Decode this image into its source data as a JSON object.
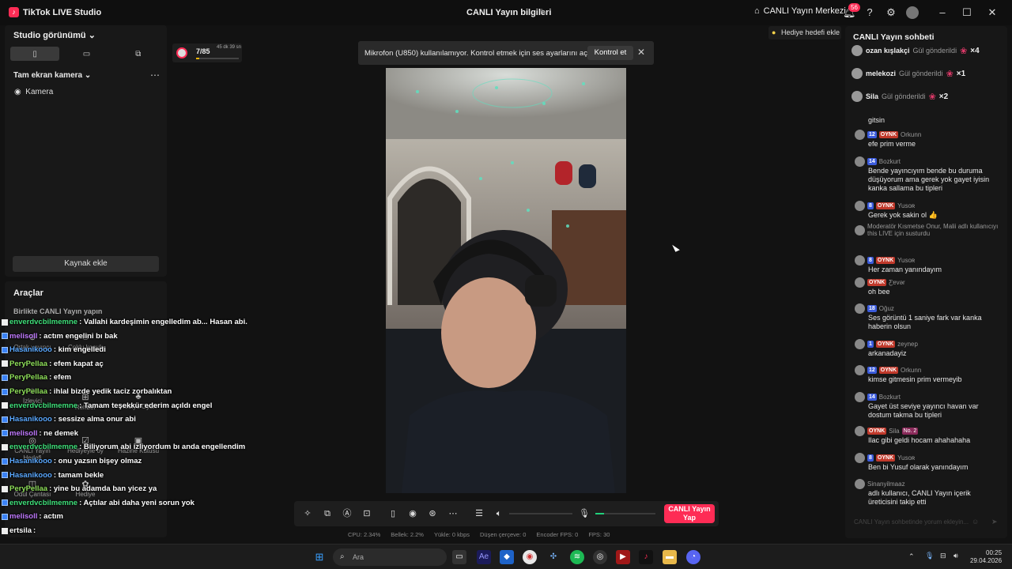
{
  "titlebar": {
    "app_title": "TikTok LIVE Studio",
    "center_title": "CANLI Yayın bilgileri",
    "center_link": "CANLI Yayın Merkezi",
    "notif_count": "56"
  },
  "left_panel": {
    "studio_view": "Studio görünümü",
    "scene_name": "Tam ekran kamera",
    "source_camera": "Kamera",
    "add_source": "Kaynak ekle"
  },
  "tools": {
    "title": "Araçlar",
    "subtitle": "Birlikte CANLI Yayın yapın",
    "items": [
      "Ortak yayıncı",
      "Çoklu konuk",
      "İzleyici",
      "Rehber",
      "Hediye Oyun",
      "CANLI Yayın Hedefi",
      "Hediyeyle oy",
      "Hazine Kutusu",
      "Ödül Çantası",
      "Hediye"
    ]
  },
  "overlay_chat": [
    {
      "user": "enverdvcbilmemne",
      "text": ": Vallahi kardeşimin engelledim ab... Hasan abi.",
      "ucolor": "#3fe07a"
    },
    {
      "user": "melisoll",
      "text": ": actım engelini bı bak",
      "ucolor": "#c07aff"
    },
    {
      "user": "Hasanikooo",
      "text": ": kim engelledi",
      "ucolor": "#5aa8ff"
    },
    {
      "user": "PeryPellaa",
      "text": ": efem kapat aç",
      "ucolor": "#8fe05a"
    },
    {
      "user": "PeryPellaa",
      "text": ": efem",
      "ucolor": "#8fe05a"
    },
    {
      "user": "PeryPellaa",
      "text": ": ihlal bizde yedik taciz zorbalıktan",
      "ucolor": "#8fe05a"
    },
    {
      "user": "enverdvcbilmemne",
      "text": ": Tamam teşekkür ederim açıldı engel",
      "ucolor": "#3fe07a"
    },
    {
      "user": "Hasanikooo",
      "text": ": sessize alma onur abi",
      "ucolor": "#5aa8ff"
    },
    {
      "user": "melisoll",
      "text": ": ne demek",
      "ucolor": "#c07aff"
    },
    {
      "user": "enverdvcbilmemne",
      "text": ": Biliyorum abi izliyordum bı anda engellendim",
      "ucolor": "#3fe07a"
    },
    {
      "user": "Hasanikooo",
      "text": ": onu yazsın bişey olmaz",
      "ucolor": "#5aa8ff"
    },
    {
      "user": "Hasanikooo",
      "text": ": tamam bekle",
      "ucolor": "#5aa8ff"
    },
    {
      "user": "PeryPellaa",
      "text": ": yine bu adamda ban yicez ya",
      "ucolor": "#8fe05a"
    },
    {
      "user": "enverdvcbilmemne",
      "text": ": Açtılar abi daha yeni sorun yok",
      "ucolor": "#3fe07a"
    },
    {
      "user": "melisoll",
      "text": ": actım",
      "ucolor": "#c07aff"
    },
    {
      "user": "ertsila",
      "text": ":",
      "ucolor": "#ffffff"
    }
  ],
  "stat": {
    "value": "7/85",
    "time": "45 dk 39 sn",
    "progress": 0.08
  },
  "mic_toast": {
    "message": "Mikrofon (U850) kullanılamıyor. Kontrol etmek için ses ayarlarını açın.",
    "button": "Kontrol et"
  },
  "goal_button": "Hediye hedefi ekle",
  "toolbar": {
    "go_live": "CANLI Yayın Yap",
    "mic_level": 0.15
  },
  "status": {
    "cpu": "CPU:  2.34%",
    "mem": "Bellek:  2.2%",
    "upload": "Yükle:  0 kbps",
    "dropped": "Düşen çerçeve:  0",
    "encoder": "Encoder FPS:  0",
    "fps": "FPS:  30"
  },
  "chat": {
    "title": "CANLI Yayın sohbeti",
    "gifts": [
      {
        "name": "ozan kışlakçi",
        "action": "Gül gönderildi",
        "count": "×4"
      },
      {
        "name": "melekozi",
        "action": "Gül gönderildi",
        "count": "×1"
      },
      {
        "name": "Sila",
        "action": "Gül gönderildi",
        "count": "×2"
      }
    ],
    "messages": [
      {
        "lvl": "",
        "oy": "",
        "user": "",
        "text": "gitsin"
      },
      {
        "lvl": "12",
        "oy": "OYNK",
        "user": "Orkunn",
        "text": "efe prim verme"
      },
      {
        "lvl": "14",
        "oy": "",
        "user": "Bozkurt",
        "text": "Bende yayıncıyım bende bu duruma düşüyorum ama gerek yok gayet iyisin kanka sallama bu tipleri"
      },
      {
        "lvl": "8",
        "oy": "OYNK",
        "user": "Yusoʀ",
        "text": "Gerek yok sakin ol 👍"
      },
      {
        "lvl": "",
        "oy": "",
        "user": "Moderatör Kısmetse Onur, Malii adlı kullanıcıyı this LIVE için susturdu",
        "text": ""
      },
      {
        "lvl": "8",
        "oy": "OYNK",
        "user": "Yusoʀ",
        "text": "Her zaman yanındayım"
      },
      {
        "lvl": "",
        "oy": "OYNK",
        "user": "Ƹɐvǝr",
        "text": "oh bee"
      },
      {
        "lvl": "18",
        "oy": "",
        "user": "Oğuz",
        "text": "Ses görüntü 1 saniye fark var kanka haberin olsun"
      },
      {
        "lvl": "1",
        "oy": "OYNK",
        "user": "zeynep",
        "text": "arkanadayiz"
      },
      {
        "lvl": "12",
        "oy": "OYNK",
        "user": "Orkunn",
        "text": "kimse gitmesin prim vermeyib"
      },
      {
        "lvl": "14",
        "oy": "",
        "user": "Bozkurt",
        "text": "Gayet üst seviye yayıncı havan var dostum takma bu tipleri"
      },
      {
        "lvl": "",
        "oy": "OYNK",
        "user": "Sila",
        "no": "No. 2",
        "text": "Ilac gibi geldi hocam ahahahaha"
      },
      {
        "lvl": "8",
        "oy": "OYNK",
        "user": "Yusoʀ",
        "text": "Ben bi Yusuf olarak yanındayım"
      },
      {
        "lvl": "",
        "oy": "",
        "user": "Sinanyilmaaz",
        "text": "adlı kullanıcı, CANLI Yayın içerik üreticisini takip etti"
      }
    ],
    "input_placeholder": "CANLI Yayın sohbetinde yorum ekleyin..."
  },
  "taskbar": {
    "search": "Ara",
    "time": "00:25",
    "date": "29.04.2026"
  }
}
